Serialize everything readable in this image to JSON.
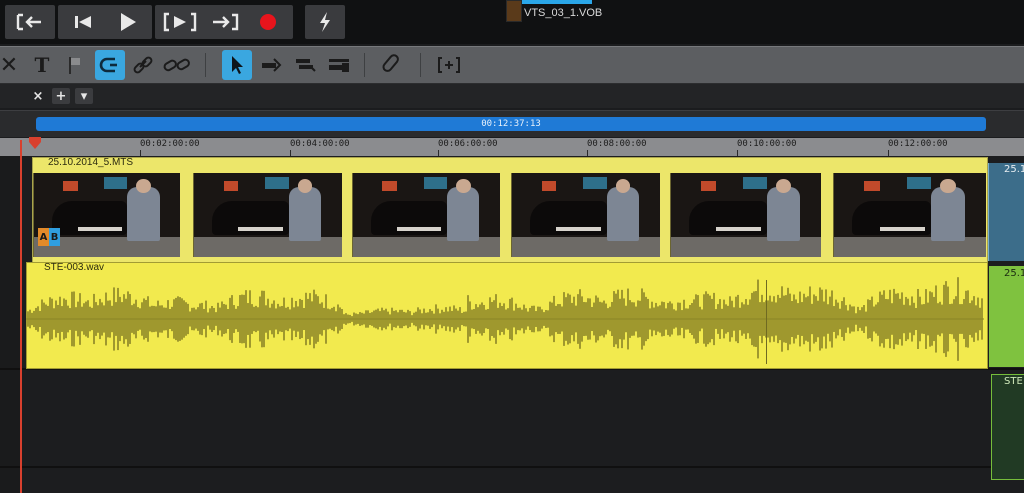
{
  "transport": {
    "buttons": [
      {
        "label": "[←",
        "name": "go-to-start-button"
      },
      {
        "label": "⏮",
        "name": "previous-marker-button"
      },
      {
        "label": "▶",
        "name": "play-button"
      },
      {
        "label": "[▶]",
        "name": "play-range-button"
      },
      {
        "label": "→]",
        "name": "go-to-end-button"
      },
      {
        "label": "●",
        "name": "record-button"
      },
      {
        "label": "⚡",
        "name": "render-button"
      }
    ],
    "current_file": "VTS_03_1.VOB",
    "colors": {
      "record": "#e8141c",
      "progress": "#2aa6e8"
    }
  },
  "toolbar": {
    "tools": [
      {
        "label": "✕",
        "name": "delete-tool"
      },
      {
        "label": "T",
        "name": "title-tool"
      },
      {
        "label": "⚑",
        "name": "marker-tool"
      },
      {
        "label": "↺",
        "name": "ripple-tool",
        "active": true
      },
      {
        "label": "🔗",
        "name": "link-tool"
      },
      {
        "label": "⛓",
        "name": "unlink-tool"
      },
      {
        "label": "↖",
        "name": "select-tool",
        "active": true
      },
      {
        "label": "⤵",
        "name": "trim-tool"
      },
      {
        "label": "✂",
        "name": "razor-tool"
      },
      {
        "label": "▭",
        "name": "slip-tool"
      },
      {
        "label": "📎",
        "name": "attach-tool"
      },
      {
        "label": "[+]",
        "name": "add-marker-tool"
      }
    ],
    "accent": "#3aa7e0"
  },
  "tabs": {
    "close": "×",
    "add": "+",
    "menu": "▾"
  },
  "range": {
    "duration": "00:12:37:13",
    "color": "#1f7ad6"
  },
  "ruler": {
    "labels": [
      "00:02:00:00",
      "00:04:00:00",
      "00:06:00:00",
      "00:08:00:00",
      "00:10:00:00",
      "00:12:00:00"
    ]
  },
  "tracks": {
    "video_clip": {
      "name": "25.10.2014_5.MTS",
      "badge_a": "A",
      "badge_b": "B",
      "color": "#ece66a"
    },
    "audio_clip": {
      "name": "STE-003.wav",
      "color": "#f2ea4e"
    },
    "next_video_label": "25.1",
    "next_audio_label": "25.1",
    "next_clip3_label": "STE"
  },
  "playhead": {
    "color": "#d8402e"
  }
}
